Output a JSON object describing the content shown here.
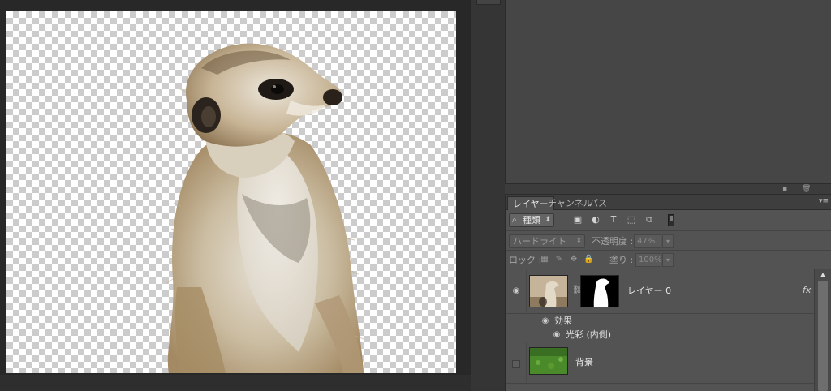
{
  "layers_panel": {
    "tabs": [
      {
        "label": "レイヤー"
      },
      {
        "label": "チャンネル"
      },
      {
        "label": "パス"
      }
    ],
    "filter": {
      "kind_label": "種類"
    },
    "blend": {
      "mode": "ハードライト",
      "opacity_label": "不透明度 :",
      "opacity_value": "47%"
    },
    "lock": {
      "label": "ロック :",
      "fill_label": "塗り :",
      "fill_value": "100%"
    },
    "layers": [
      {
        "name": "レイヤー 0",
        "fx_label": "fx",
        "effects_label": "効果",
        "effect_item": "光彩 (内側)"
      },
      {
        "name": "背景"
      }
    ]
  },
  "colors": {
    "accent_panel": "#535353",
    "dark_bg": "#282828",
    "bg_thumb_green": "#4a8a2a"
  },
  "icons": [
    "search-icon",
    "image-filter-icon",
    "adjustment-filter-icon",
    "type-filter-icon",
    "shape-filter-icon",
    "smart-object-filter-icon",
    "eye-icon",
    "link-chain-icon",
    "lock-icon",
    "new-layer-icon",
    "trash-icon",
    "panel-menu-icon"
  ]
}
